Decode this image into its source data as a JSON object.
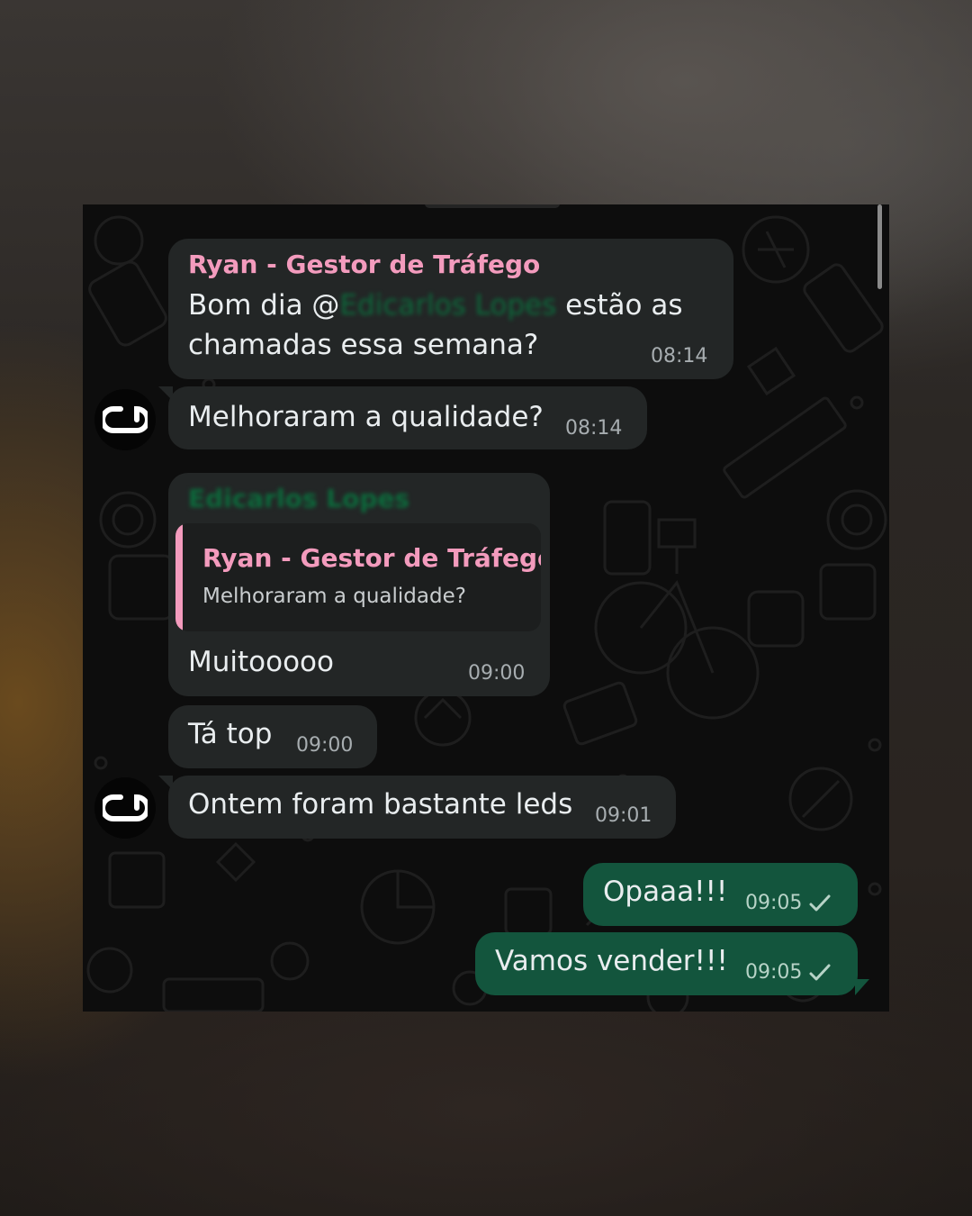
{
  "chat": {
    "messages": [
      {
        "sender": "Ryan - Gestor de Tráfego",
        "text_before": "Bom dia @",
        "mention": "Edicarlos Lopes",
        "text_after": " estão as",
        "text_line2": "chamadas essa semana?",
        "time": "08:14"
      },
      {
        "text": "Melhoraram a qualidade?",
        "time": "08:14"
      },
      {
        "sender": "Edicarlos Lopes",
        "quoted_sender": "Ryan - Gestor de Tráfego",
        "quoted_text": "Melhoraram a qualidade?",
        "text": "Muitooooo",
        "time": "09:00"
      },
      {
        "text": "Tá top",
        "time": "09:00"
      },
      {
        "text": "Ontem foram bastante leds",
        "time": "09:01"
      },
      {
        "text": "Opaaa!!!",
        "time": "09:05"
      },
      {
        "text": "Vamos vender!!!",
        "time": "09:05"
      }
    ]
  },
  "colors": {
    "incoming_bubble": "#232626",
    "outgoing_bubble": "#13553d",
    "sender_name": "#f39bbd",
    "chat_background": "#0d0d0d"
  },
  "icons": [
    "avatar-logo-icon",
    "single-check-icon"
  ]
}
